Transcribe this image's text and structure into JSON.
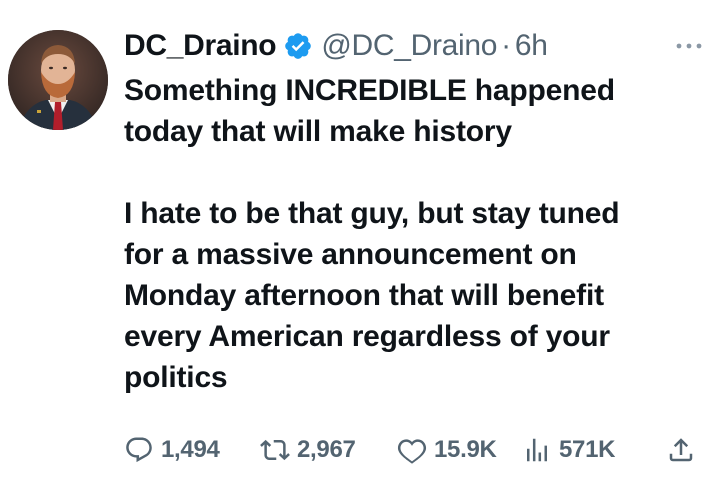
{
  "author": {
    "display_name": "DC_Draino",
    "handle": "@DC_Draino",
    "separator": "·",
    "time": "6h",
    "verified_color": "#1d9bf0"
  },
  "tweet": {
    "paragraph_1": "Something INCREDIBLE happened\ntoday that will make history",
    "paragraph_2": "I hate to be that guy, but stay tuned\nfor a massive announcement on\nMonday afternoon that will benefit\nevery American regardless of your\npolitics"
  },
  "actions": {
    "replies": "1,494",
    "retweets": "2,967",
    "likes": "15.9K",
    "views": "571K"
  },
  "icons": {
    "reply": "reply-icon",
    "retweet": "retweet-icon",
    "like": "heart-icon",
    "views": "views-icon",
    "share": "share-icon",
    "more": "more-icon",
    "verified": "verified-badge-icon"
  },
  "colors": {
    "text_primary": "#0f1419",
    "text_secondary": "#536471",
    "verified": "#1d9bf0"
  }
}
